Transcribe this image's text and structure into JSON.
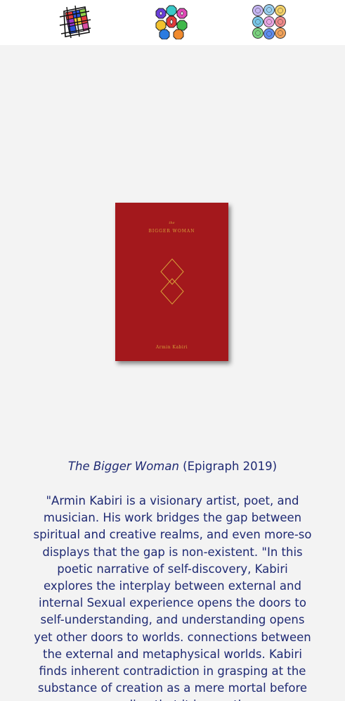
{
  "nav": {
    "items": [
      {
        "icon": "geometric-lattice-icon"
      },
      {
        "icon": "octagon-star-pattern-icon"
      },
      {
        "icon": "rosette-grid-icon"
      }
    ]
  },
  "book": {
    "cover_the": "the",
    "cover_title": "BIGGER WOMAN",
    "cover_author": "Armin Kabiri",
    "cover_color": "#a3181c",
    "cover_text_color": "#d7a13a"
  },
  "caption": {
    "title": "The Bigger Woman",
    "publisher": " (Epigraph 2019)"
  },
  "description": "\"Armin Kabiri is a visionary artist, poet, and musician. His work bridges the gap between spiritual and creative realms, and even more-so displays that the gap is non-existent. \"In this poetic narrative of self-discovery, Kabiri explores the interplay between external and internal Sexual experience opens the doors to self-understanding, and understanding opens yet other doors to worlds. connections between the external and metaphysical worlds. Kabiri finds inherent contradiction in grasping at the substance of creation as a mere mortal before revealing that it is exactly"
}
